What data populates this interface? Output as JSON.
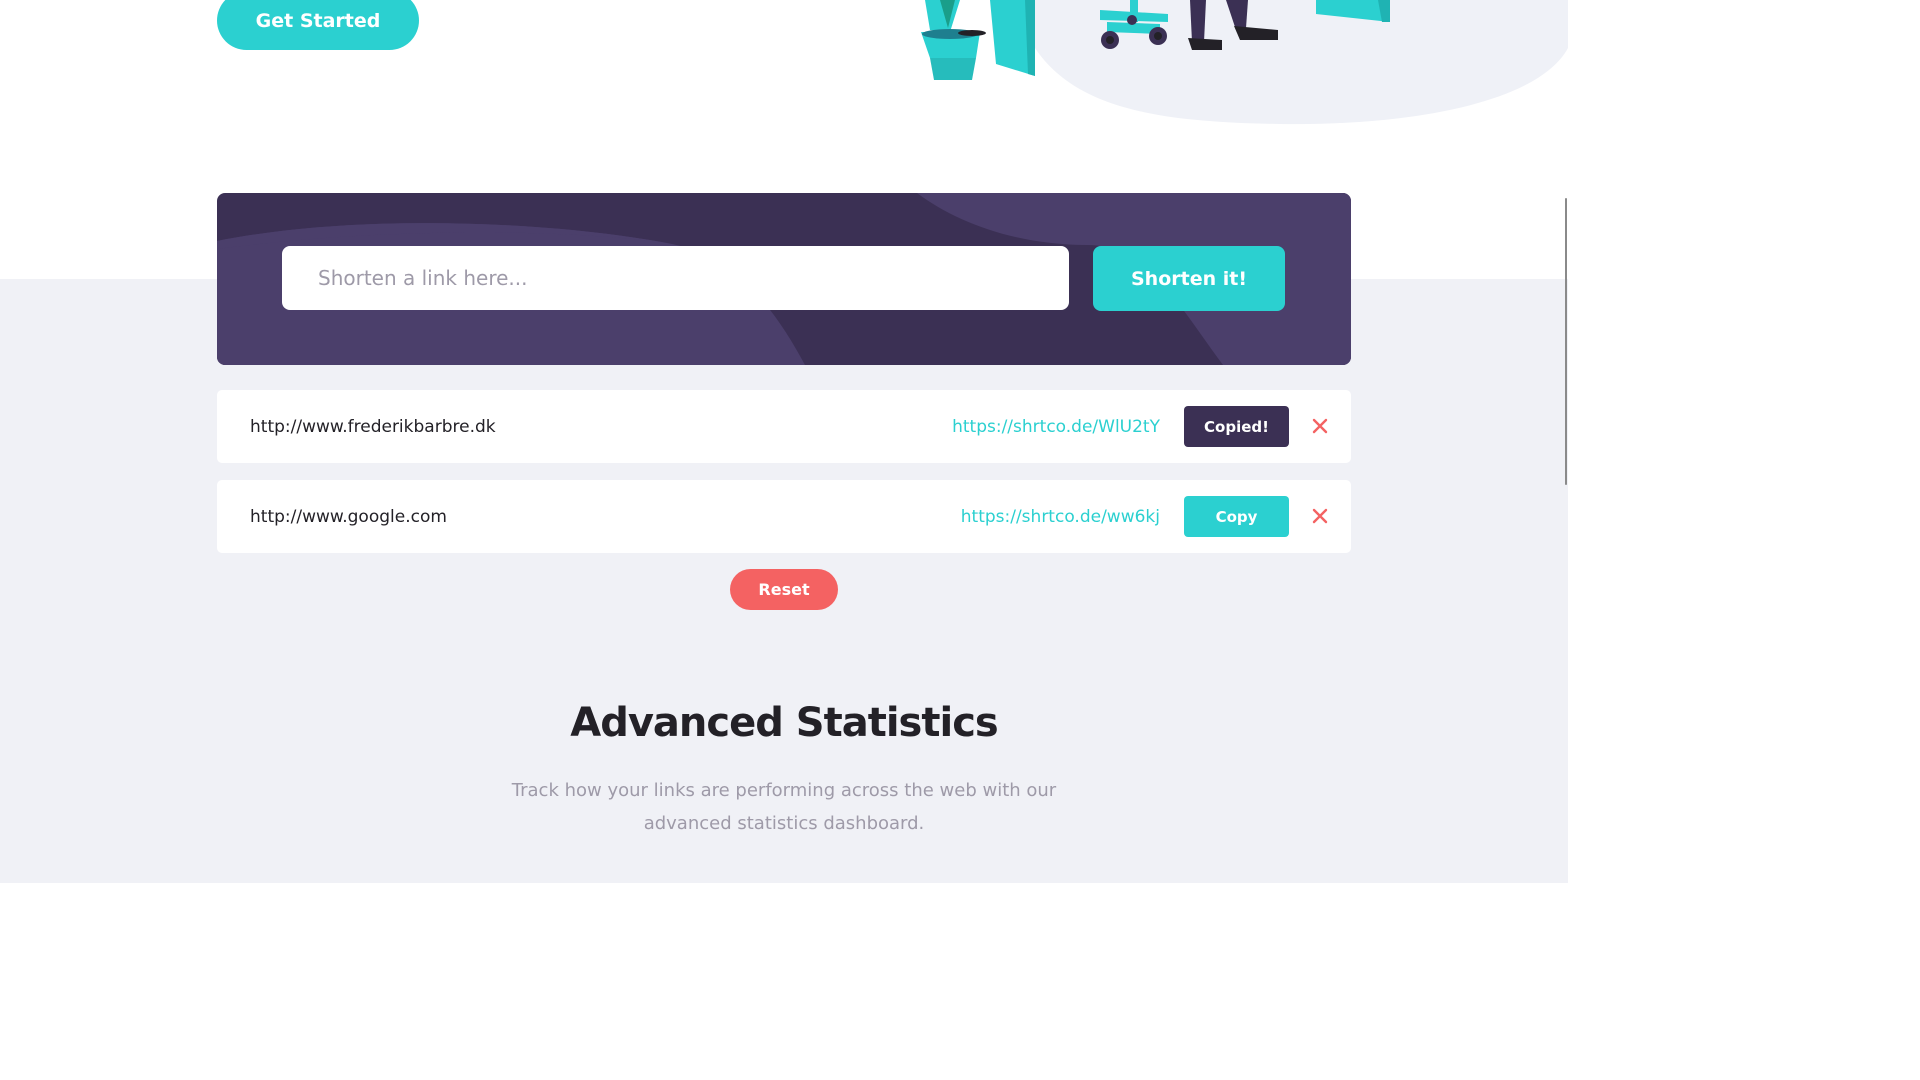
{
  "hero": {
    "get_started_label": "Get Started"
  },
  "shortener": {
    "input_placeholder": "Shorten a link here...",
    "submit_label": "Shorten it!"
  },
  "results": [
    {
      "original": "http://www.frederikbarbre.dk",
      "short": "https://shrtco.de/WlU2tY",
      "copy_label": "Copied!",
      "copy_state": "copied"
    },
    {
      "original": "http://www.google.com",
      "short": "https://shrtco.de/ww6kj",
      "copy_label": "Copy",
      "copy_state": "default"
    }
  ],
  "reset_label": "Reset",
  "statistics": {
    "title": "Advanced Statistics",
    "description": "Track how your links are performing across the web with our advanced statistics dashboard."
  },
  "icons": {
    "delete": "close-icon"
  },
  "colors": {
    "cyan": "#2bd0d0",
    "dark_violet": "#3b3054",
    "red": "#f46262",
    "grayish_violet": "#9e9aa8",
    "very_dark_blue": "#232127"
  }
}
